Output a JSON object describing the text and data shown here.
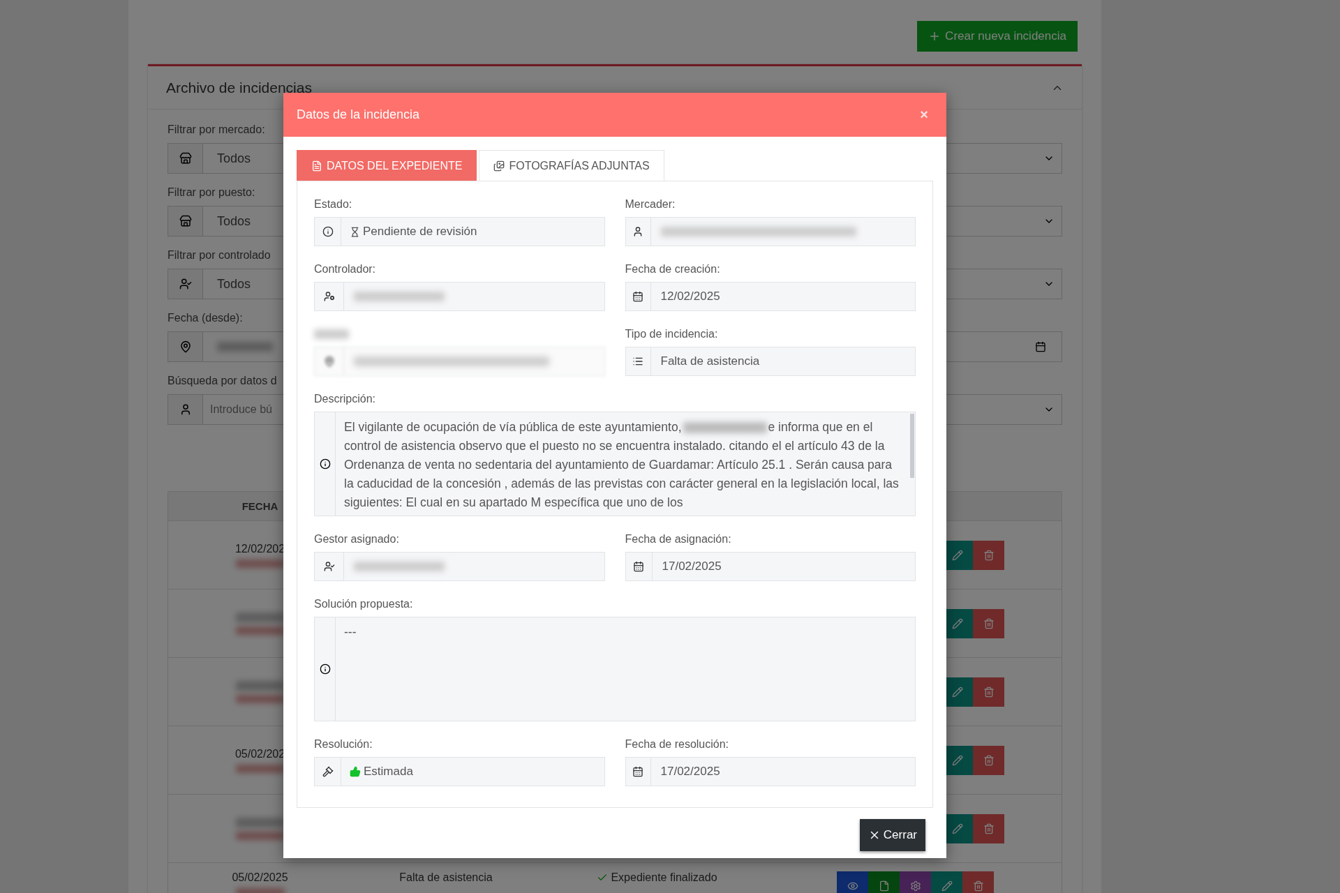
{
  "page": {
    "create_button": "Crear nueva incidencia",
    "card": {
      "title": "Archivo de incidencias",
      "filters": [
        {
          "label": "Filtrar por mercado:",
          "value": "Todos",
          "kind": "select"
        },
        {
          "label": "Filtrar por puesto:",
          "value": "Todos",
          "kind": "select"
        },
        {
          "label": "Filtrar por controlado",
          "value": "Todos",
          "kind": "select"
        },
        {
          "label": "Fecha (desde):",
          "kind": "date"
        },
        {
          "label": "Búsqueda por datos d",
          "placeholder": "Introduce bú",
          "kind": "select"
        }
      ],
      "table": {
        "columns": [
          "FECHA"
        ],
        "rows": [
          {
            "date": "12/02/202",
            "kind": "edit"
          },
          {
            "kind": "edit"
          },
          {
            "kind": "edit"
          },
          {
            "date": "05/02/202",
            "kind": "edit"
          },
          {
            "kind": "edit"
          },
          {
            "date": "05/02/2025",
            "column_2": "Falta de asistencia",
            "column_3": "Expediente finalizado",
            "kind": "full"
          }
        ]
      }
    }
  },
  "modal": {
    "title": "Datos de la incidencia",
    "close": "×",
    "tabs": [
      {
        "label": "DATOS DEL EXPEDIENTE",
        "selected": true
      },
      {
        "label": "FOTOGRAFÍAS ADJUNTAS",
        "selected": false
      }
    ],
    "fields": [
      {
        "label": "Estado:",
        "value": "Pendiente de revisión",
        "kind": "input"
      },
      {
        "label": "Mercader:",
        "kind": "redacted"
      },
      {
        "label": "Controlador:",
        "kind": "redacted"
      },
      {
        "label": "Fecha de creación:",
        "value": "12/02/2025",
        "kind": "input"
      },
      {
        "kind": "redacted"
      },
      {
        "label": "Tipo de incidencia:",
        "value": "Falta de asistencia",
        "kind": "input"
      },
      {
        "label": "Descripción:",
        "kind": "textarea",
        "before": "El vigilante de ocupación de vía pública de este ayuntamiento,",
        "after": "e informa que en el control de asistencia observo que el puesto no se encuentra instalado. citando  el el artículo 43 de la Ordenanza de venta no sedentaria del ayuntamiento de Guardamar: Artículo 25.1 . Serán causa para la caducidad de la concesión , además de las previstas con carácter general en la legislación local, las siguientes: El cual en su apartado M específica que uno de los"
      },
      {
        "label": "Gestor asignado:",
        "kind": "redacted"
      },
      {
        "label": "Fecha de asignación:",
        "value": "17/02/2025",
        "kind": "input"
      },
      {
        "label": "Solución propuesta:",
        "kind": "textarea",
        "after": "---"
      },
      {
        "label": "Resolución:",
        "value": "Estimada",
        "kind": "input"
      },
      {
        "label": "Fecha de resolución:",
        "value": "17/02/2025",
        "kind": "input"
      }
    ],
    "close_button": "Cerrar"
  }
}
